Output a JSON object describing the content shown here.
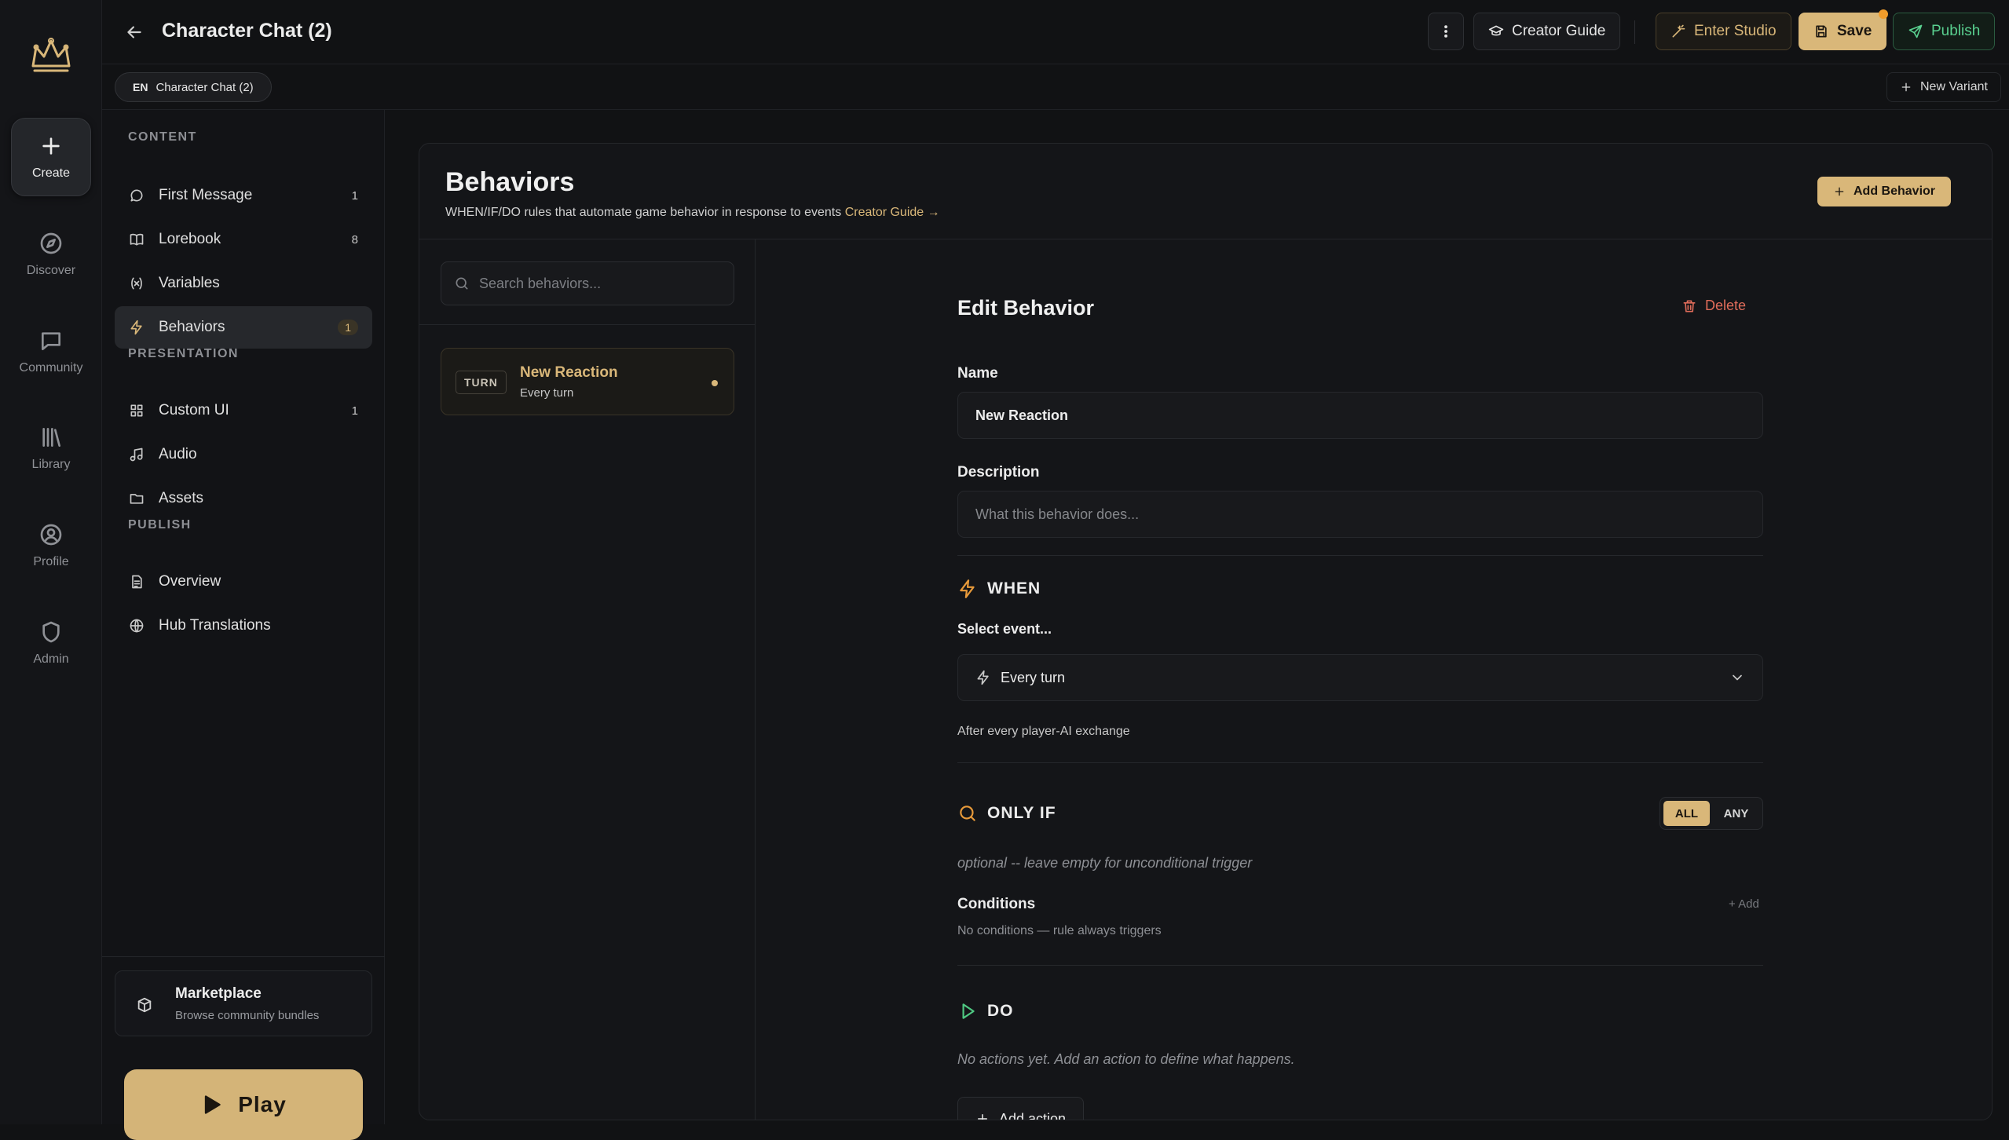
{
  "rail": {
    "items": [
      {
        "label": "Create",
        "icon": "plus-icon"
      },
      {
        "label": "Discover",
        "icon": "compass-icon"
      },
      {
        "label": "Community",
        "icon": "chat-bubble-icon"
      },
      {
        "label": "Library",
        "icon": "library-icon"
      },
      {
        "label": "Profile",
        "icon": "user-circle-icon"
      },
      {
        "label": "Admin",
        "icon": "shield-icon"
      }
    ]
  },
  "topbar": {
    "title": "Character Chat (2)",
    "creator_guide": "Creator Guide",
    "enter_studio": "Enter Studio",
    "save": "Save",
    "publish": "Publish"
  },
  "subbar": {
    "lang_code": "EN",
    "lang_name": "Character Chat (2)",
    "new_variant": "New Variant"
  },
  "sidenav": {
    "content_label": "CONTENT",
    "presentation_label": "PRESENTATION",
    "publish_label": "PUBLISH",
    "content_items": [
      {
        "label": "First Message",
        "count": "1",
        "icon": "message-icon"
      },
      {
        "label": "Lorebook",
        "count": "8",
        "icon": "book-icon"
      },
      {
        "label": "Variables",
        "count": "",
        "icon": "variable-icon"
      },
      {
        "label": "Behaviors",
        "count": "1",
        "icon": "lightning-icon"
      }
    ],
    "presentation_items": [
      {
        "label": "Custom UI",
        "count": "1",
        "icon": "grid-icon"
      },
      {
        "label": "Audio",
        "count": "",
        "icon": "music-icon"
      },
      {
        "label": "Assets",
        "count": "",
        "icon": "folder-icon"
      }
    ],
    "publish_items": [
      {
        "label": "Overview",
        "count": "",
        "icon": "document-icon"
      },
      {
        "label": "Hub Translations",
        "count": "",
        "icon": "globe-icon"
      }
    ],
    "marketplace_title": "Marketplace",
    "marketplace_sub": "Browse community bundles",
    "play": "Play"
  },
  "main": {
    "title": "Behaviors",
    "description": "WHEN/IF/DO rules that automate game behavior in response to events",
    "guide_link": "Creator Guide →",
    "add_behavior": "Add Behavior",
    "search_placeholder": "Search behaviors...",
    "behaviors": [
      {
        "badge": "TURN",
        "name": "New Reaction",
        "trigger": "Every turn"
      }
    ]
  },
  "editor": {
    "title": "Edit Behavior",
    "delete": "Delete",
    "name_label": "Name",
    "name_value": "New Reaction",
    "description_label": "Description",
    "description_placeholder": "What this behavior does...",
    "when_label": "WHEN",
    "select_event_label": "Select event...",
    "event_value": "Every turn",
    "event_hint": "After every player-AI exchange",
    "only_if_label": "ONLY IF",
    "mode_all": "ALL",
    "mode_any": "ANY",
    "only_if_hint": "optional -- leave empty for unconditional trigger",
    "conditions_label": "Conditions",
    "add_condition": "+ Add",
    "no_conditions": "No conditions — rule always triggers",
    "do_label": "DO",
    "no_actions": "No actions yet. Add an action to define what happens.",
    "add_action": "Add action"
  },
  "colors": {
    "accent_gold": "#d9b779",
    "publish_green": "#59d08f",
    "delete_red": "#e06c5a",
    "when_orange": "#e89a3a",
    "background": "#111214"
  }
}
